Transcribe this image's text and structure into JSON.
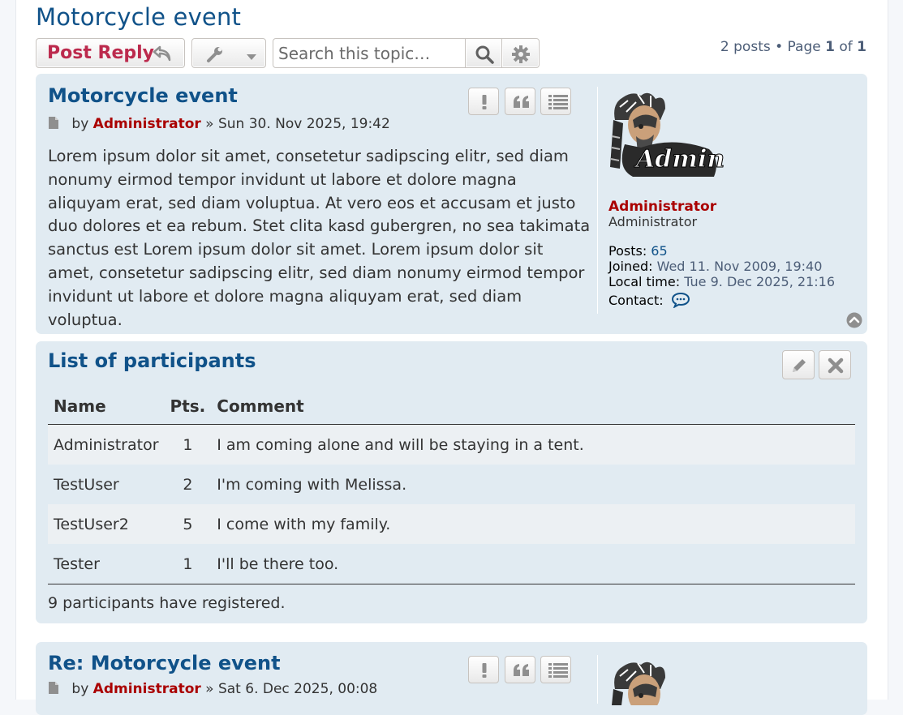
{
  "page": {
    "title": "Motorcycle event"
  },
  "actionbar": {
    "post_reply_label": "Post Reply",
    "search_placeholder": "Search this topic…",
    "pagination": {
      "posts_text": "2 posts • Page",
      "current": "1",
      "of": "of",
      "total": "1"
    }
  },
  "post1": {
    "title": "Motorcycle event",
    "by": "by",
    "author": "Administrator",
    "date": "» Sun 30. Nov 2025, 19:42",
    "content": "Lorem ipsum dolor sit amet, consetetur sadipscing elitr, sed diam nonumy eirmod tempor invidunt ut labore et dolore magna aliquyam erat, sed diam voluptua. At vero eos et accusam et justo duo dolores et ea rebum. Stet clita kasd gubergren, no sea takimata sanctus est Lorem ipsum dolor sit amet. Lorem ipsum dolor sit amet, consetetur sadipscing elitr, sed diam nonumy eirmod tempor invidunt ut labore et dolore magna aliquyam erat, sed diam voluptua.",
    "profile": {
      "avatar_text": "Admin",
      "name": "Administrator",
      "rank": "Administrator",
      "posts_label": "Posts:",
      "posts": "65",
      "joined_label": "Joined:",
      "joined": "Wed 11. Nov 2009, 19:40",
      "localtime_label": "Local time:",
      "localtime": "Tue 9. Dec 2025, 21:16",
      "contact_label": "Contact:"
    }
  },
  "participants": {
    "title": "List of participants",
    "headers": {
      "name": "Name",
      "pts": "Pts.",
      "comment": "Comment"
    },
    "rows": [
      {
        "name": "Administrator",
        "pts": "1",
        "comment": "I am coming alone and will be staying in a tent."
      },
      {
        "name": "TestUser",
        "pts": "2",
        "comment": "I'm coming with Melissa."
      },
      {
        "name": "TestUser2",
        "pts": "5",
        "comment": "I come with my family."
      },
      {
        "name": "Tester",
        "pts": "1",
        "comment": "I'll be there too."
      }
    ],
    "summary": "9 participants have registered."
  },
  "post2": {
    "title": "Re: Motorcycle event",
    "by": "by",
    "author": "Administrator",
    "date": "» Sat 6. Dec 2025, 00:08"
  },
  "colors": {
    "link": "#105289",
    "username": "#aa0000",
    "panel": "#e1ebf2",
    "reply": "#bc2a4d"
  },
  "icons": [
    "reply-icon",
    "wrench-icon",
    "caret-down-icon",
    "search-icon",
    "gear-icon",
    "exclamation-icon",
    "quote-icon",
    "list-icon",
    "document-icon",
    "speech-bubble-icon",
    "top-arrow-icon",
    "pencil-icon",
    "close-icon"
  ]
}
